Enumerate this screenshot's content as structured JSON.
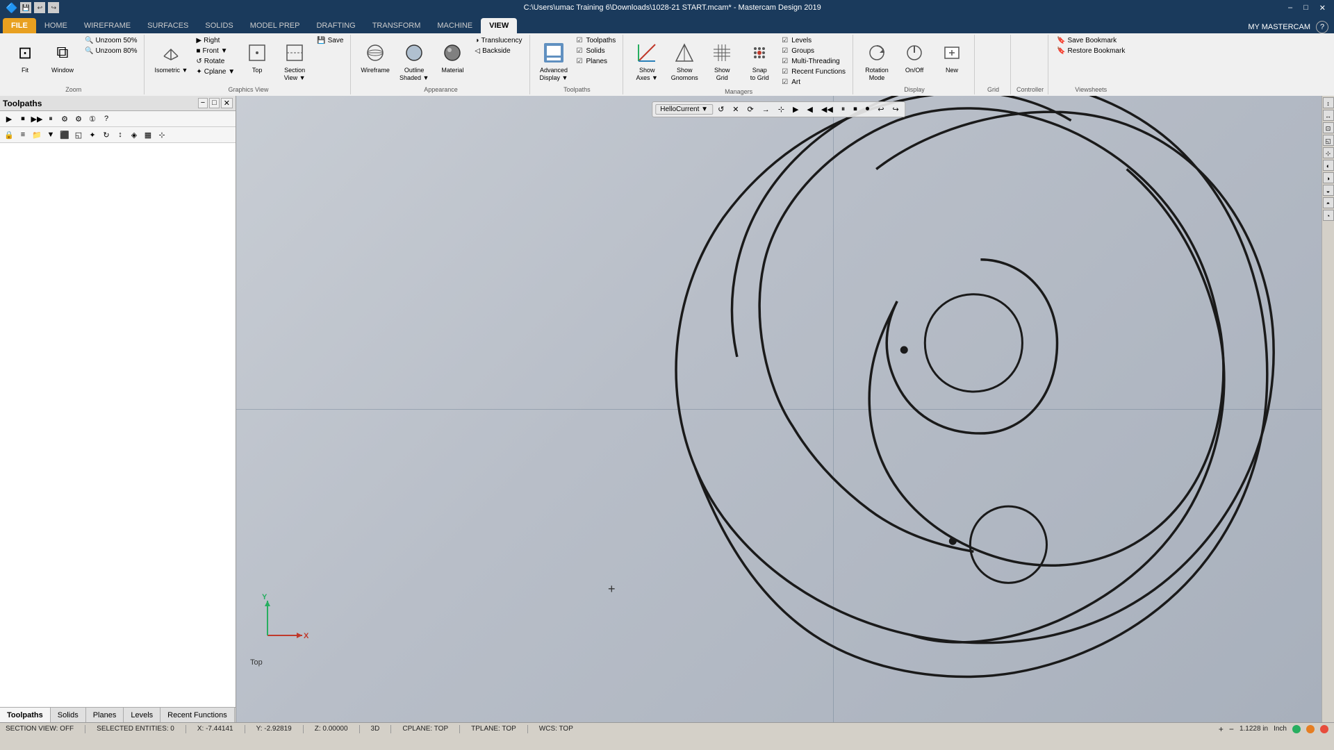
{
  "titleBar": {
    "title": "C:\\Users\\umac Training 6\\Downloads\\1028-21 START.mcam* - Mastercam Design 2019",
    "winBtns": [
      "–",
      "□",
      "✕"
    ]
  },
  "ribbonTabs": [
    {
      "id": "file",
      "label": "FILE",
      "active": false,
      "special": "file"
    },
    {
      "id": "home",
      "label": "HOME",
      "active": false
    },
    {
      "id": "wireframe",
      "label": "WIREFRAME",
      "active": false
    },
    {
      "id": "surfaces",
      "label": "SURFACES",
      "active": false
    },
    {
      "id": "solids",
      "label": "SOLIDS",
      "active": false
    },
    {
      "id": "model-prep",
      "label": "MODEL PREP",
      "active": false
    },
    {
      "id": "drafting",
      "label": "DRAFTING",
      "active": false
    },
    {
      "id": "transform",
      "label": "TRANSFORM",
      "active": false
    },
    {
      "id": "machine",
      "label": "MACHINE",
      "active": false
    },
    {
      "id": "view",
      "label": "VIEW",
      "active": true
    }
  ],
  "ribbonGroups": {
    "zoom": {
      "label": "Zoom",
      "items": [
        {
          "icon": "⊡",
          "label": "Fit",
          "type": "large"
        },
        {
          "icon": "⧉",
          "label": "Window",
          "type": "large"
        },
        {
          "icon": "🔍",
          "label": "Unzoom 50%",
          "type": "small"
        },
        {
          "icon": "🔍",
          "label": "Unzoom 80%",
          "type": "small"
        }
      ]
    },
    "graphicsView": {
      "label": "Graphics View",
      "items": [
        {
          "icon": "⊹",
          "label": "Isometric",
          "type": "large"
        },
        {
          "icon": "▶",
          "label": "Right",
          "type": "small"
        },
        {
          "icon": "▼",
          "label": "Front",
          "type": "small"
        },
        {
          "icon": "⬆",
          "label": "Top",
          "type": "large"
        },
        {
          "icon": "◱",
          "label": "Rotate",
          "type": "small"
        },
        {
          "icon": "✦",
          "label": "Cplane",
          "type": "small"
        },
        {
          "icon": "▦",
          "label": "Section View",
          "type": "large"
        },
        {
          "icon": "💾",
          "label": "Save",
          "type": "small"
        }
      ]
    },
    "appearance": {
      "label": "Appearance",
      "items": [
        {
          "icon": "◈",
          "label": "Wireframe",
          "type": "large"
        },
        {
          "icon": "■",
          "label": "Outline Shaded",
          "type": "large"
        },
        {
          "icon": "●",
          "label": "Material",
          "type": "large"
        },
        {
          "icon": "◐",
          "label": "Translucency",
          "type": "small"
        },
        {
          "icon": "◁",
          "label": "Backside",
          "type": "small"
        }
      ]
    },
    "toolpaths": {
      "label": "Toolpaths",
      "items": [
        {
          "icon": "⚙",
          "label": "Advanced Display",
          "type": "large"
        }
      ],
      "checkItems": [
        {
          "label": "Toolpaths"
        },
        {
          "label": "Solids"
        },
        {
          "label": "Planes"
        }
      ]
    },
    "managers": {
      "label": "Managers",
      "items": [
        {
          "icon": "☰",
          "label": "Show Axes",
          "type": "large"
        },
        {
          "icon": "☰",
          "label": "Show Gnomons",
          "type": "large"
        },
        {
          "icon": "☰",
          "label": "Show Grid",
          "type": "large"
        },
        {
          "icon": "⊞",
          "label": "Snap to Grid",
          "type": "large"
        }
      ],
      "checkItems": [
        {
          "label": "Levels"
        },
        {
          "label": "Groups"
        },
        {
          "label": "Multi-Threading"
        },
        {
          "label": "Recent Functions"
        },
        {
          "label": "Art"
        }
      ]
    },
    "display": {
      "label": "Display",
      "items": [
        {
          "icon": "⊞",
          "label": "Rotation Mode",
          "type": "large"
        },
        {
          "icon": "◈",
          "label": "On/Off",
          "type": "large"
        },
        {
          "icon": "✦",
          "label": "New",
          "type": "large"
        }
      ]
    },
    "grid": {
      "label": "Grid",
      "items": []
    },
    "controller": {
      "label": "Controller",
      "items": []
    },
    "viewsheets": {
      "label": "Viewsheets",
      "items": [
        {
          "icon": "🔖",
          "label": "Save Bookmark",
          "type": "small"
        },
        {
          "icon": "🔖",
          "label": "Restore Bookmark",
          "type": "small"
        }
      ]
    }
  },
  "myMastercam": "MY MASTERCAM",
  "toolpathsPanel": {
    "title": "Toolpaths",
    "toolbarRow1": [
      "▶",
      "⏹",
      "▶▶",
      "⏹⏹",
      "⚙",
      "⚙⚙",
      "①",
      "?"
    ],
    "toolbarRow2": [
      "🔒",
      "≡",
      "📁",
      "▼",
      "⬛",
      "◱",
      "✦",
      "↻",
      "↕",
      "◈",
      "▦",
      "⊹"
    ],
    "tabs": [
      {
        "id": "toolpaths",
        "label": "Toolpaths",
        "active": true
      },
      {
        "id": "solids",
        "label": "Solids",
        "active": false
      },
      {
        "id": "planes",
        "label": "Planes",
        "active": false
      },
      {
        "id": "levels",
        "label": "Levels",
        "active": false
      },
      {
        "id": "recent",
        "label": "Recent Functions",
        "active": false
      }
    ]
  },
  "viewportToolbar": {
    "items": [
      "↺",
      "⊡",
      "🔍",
      "✕",
      "⟳",
      "→",
      "↑",
      "←",
      "↓",
      "⊹",
      "▶",
      "▶▶",
      "◀◀",
      "⏸",
      "⏹",
      "⏺"
    ]
  },
  "drawing": {
    "shape": "comma-spiral",
    "viewLabel": "Top"
  },
  "statusBar": {
    "sectionView": "SECTION VIEW: OFF",
    "selectedEntities": "SELECTED ENTITIES: 0",
    "x": "X:  -7.44141",
    "y": "Y:  -2.92819",
    "z": "Z:  0.00000",
    "mode": "3D",
    "cplane": "CPLANE: TOP",
    "tplane": "TPLANE: TOP",
    "wcs": "WCS: TOP",
    "measurement": "1.1228 in",
    "unit": "Inch"
  },
  "rightPanelBtns": [
    "↕",
    "↔",
    "⊡",
    "◱",
    "⊹",
    "◐",
    "◑",
    "◒",
    "◓",
    "◔"
  ]
}
